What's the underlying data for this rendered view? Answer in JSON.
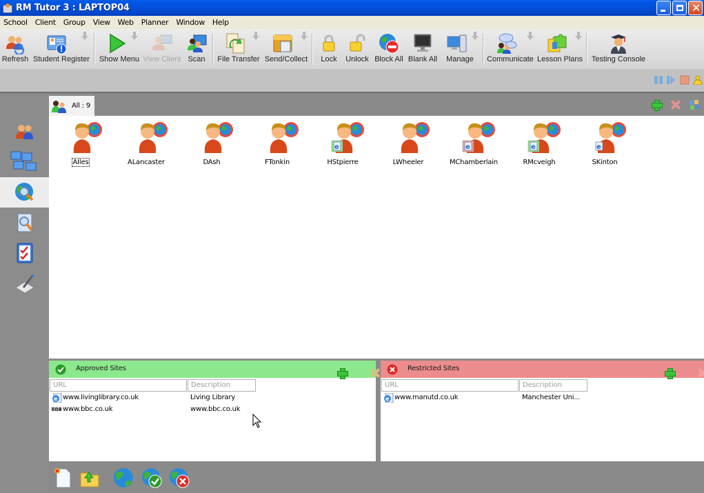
{
  "window": {
    "title": "RM Tutor 3 : LAPTOP04",
    "controls": [
      "minimize",
      "restore",
      "close"
    ]
  },
  "menubar": {
    "items": [
      "School",
      "Client",
      "Group",
      "View",
      "Web",
      "Planner",
      "Window",
      "Help"
    ]
  },
  "toolbar": {
    "buttons": [
      {
        "label": "Refresh",
        "icon": "refresh-icon",
        "enabled": true,
        "dropdown": false
      },
      {
        "label": "Student Register",
        "icon": "student-register-icon",
        "enabled": true,
        "dropdown": true
      },
      {
        "label": "Show Menu",
        "icon": "play-icon",
        "enabled": true,
        "dropdown": true
      },
      {
        "label": "View Client",
        "icon": "view-client-icon",
        "enabled": false,
        "dropdown": false
      },
      {
        "label": "Scan",
        "icon": "scan-icon",
        "enabled": true,
        "dropdown": false
      },
      {
        "label": "File Transfer",
        "icon": "file-transfer-icon",
        "enabled": true,
        "dropdown": true
      },
      {
        "label": "Send/Collect",
        "icon": "send-collect-icon",
        "enabled": true,
        "dropdown": true
      },
      {
        "label": "Lock",
        "icon": "lock-icon",
        "enabled": true,
        "dropdown": false
      },
      {
        "label": "Unlock",
        "icon": "unlock-icon",
        "enabled": true,
        "dropdown": false
      },
      {
        "label": "Block All",
        "icon": "block-all-icon",
        "enabled": true,
        "dropdown": false
      },
      {
        "label": "Blank All",
        "icon": "blank-all-icon",
        "enabled": true,
        "dropdown": false
      },
      {
        "label": "Manage",
        "icon": "manage-icon",
        "enabled": true,
        "dropdown": true
      },
      {
        "label": "Communicate",
        "icon": "communicate-icon",
        "enabled": true,
        "dropdown": true
      },
      {
        "label": "Lesson Plans",
        "icon": "lesson-plans-icon",
        "enabled": true,
        "dropdown": true
      },
      {
        "label": "Testing Console",
        "icon": "testing-console-icon",
        "enabled": true,
        "dropdown": false
      }
    ],
    "secondary_controls": [
      "pause-icon",
      "step-icon",
      "stop-icon",
      "presenter-icon"
    ]
  },
  "sidebar": {
    "items": [
      {
        "name": "students",
        "icon": "students-icon",
        "active": false
      },
      {
        "name": "network",
        "icon": "network-computers-icon",
        "active": false
      },
      {
        "name": "web",
        "icon": "web-monitor-icon",
        "active": true
      },
      {
        "name": "app-monitor",
        "icon": "app-monitor-icon",
        "active": false
      },
      {
        "name": "checklist",
        "icon": "checklist-icon",
        "active": false
      },
      {
        "name": "assess",
        "icon": "pen-assess-icon",
        "active": false
      }
    ]
  },
  "group": {
    "tab_label": "All : 9",
    "actions": [
      "add-group",
      "remove-group",
      "group-settings"
    ]
  },
  "students": [
    {
      "name": "AIles",
      "badge": null,
      "focused": true
    },
    {
      "name": "ALancaster",
      "badge": null,
      "focused": false
    },
    {
      "name": "DAsh",
      "badge": null,
      "focused": false
    },
    {
      "name": "FTonkin",
      "badge": null,
      "focused": false
    },
    {
      "name": "HStpierre",
      "badge": "approved",
      "focused": false
    },
    {
      "name": "LWheeler",
      "badge": null,
      "focused": false
    },
    {
      "name": "MChamberlain",
      "badge": "restricted",
      "focused": false
    },
    {
      "name": "RMcveigh",
      "badge": "approved",
      "focused": false
    },
    {
      "name": "SKinton",
      "badge": "neutral",
      "focused": false
    }
  ],
  "approved_sites": {
    "title": "Approved Sites",
    "columns": [
      "URL",
      "Description"
    ],
    "rows": [
      {
        "url": "www.livinglibrary.co.uk",
        "description": "Living Library",
        "icon": "ie-page-icon"
      },
      {
        "url": "www.bbc.co.uk",
        "description": "www.bbc.co.uk",
        "icon": "bbc-icon"
      }
    ]
  },
  "restricted_sites": {
    "title": "Restricted Sites",
    "columns": [
      "URL",
      "Description"
    ],
    "rows": [
      {
        "url": "www.manutd.co.uk",
        "description": "Manchester Uni...",
        "icon": "ie-page-icon"
      }
    ]
  },
  "bottom_toolbar": {
    "buttons": [
      "new-list-icon",
      "open-list-icon",
      "web-globe-icon",
      "approve-globe-icon",
      "restrict-globe-icon"
    ]
  },
  "colors": {
    "approved_header": "#8ce88c",
    "restricted_header": "#ec8c8c",
    "titlebar": "#0450d8"
  }
}
